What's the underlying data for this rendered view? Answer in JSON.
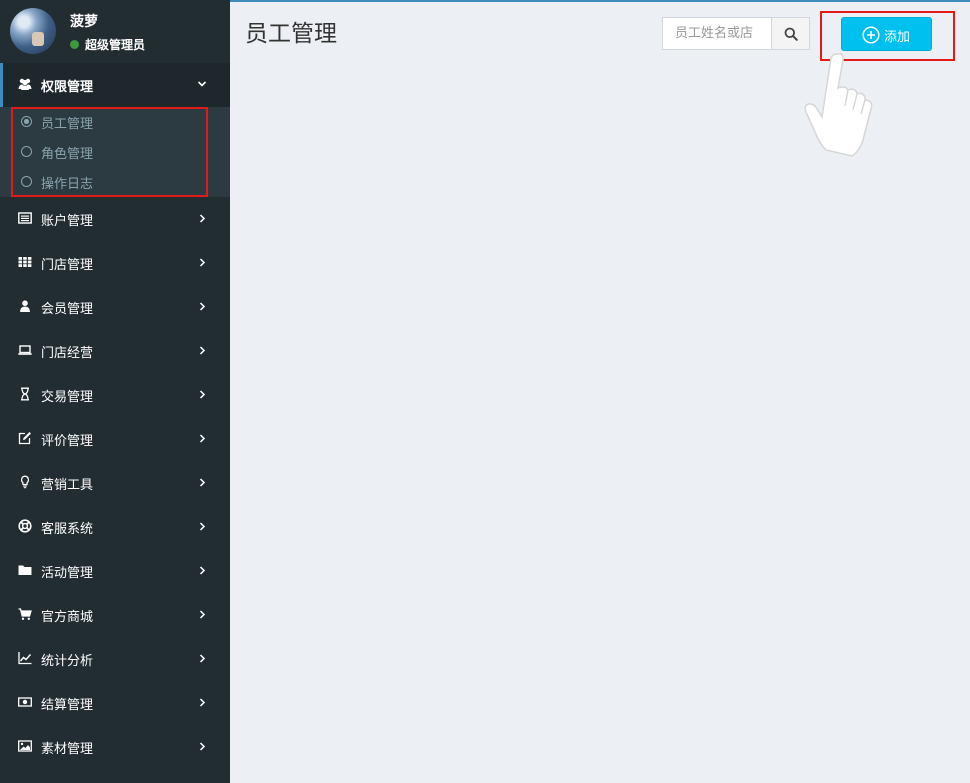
{
  "user": {
    "name": "菠萝",
    "role": "超级管理员"
  },
  "sidebar": {
    "items": [
      {
        "label": "权限管理",
        "icon": "users-icon",
        "active": true,
        "children": [
          {
            "label": "员工管理",
            "active": true
          },
          {
            "label": "角色管理",
            "active": false
          },
          {
            "label": "操作日志",
            "active": false
          }
        ]
      },
      {
        "label": "账户管理",
        "icon": "list-alt-icon"
      },
      {
        "label": "门店管理",
        "icon": "grid-icon"
      },
      {
        "label": "会员管理",
        "icon": "user-icon"
      },
      {
        "label": "门店经营",
        "icon": "laptop-icon"
      },
      {
        "label": "交易管理",
        "icon": "hourglass-icon"
      },
      {
        "label": "评价管理",
        "icon": "edit-icon"
      },
      {
        "label": "营销工具",
        "icon": "lightbulb-icon"
      },
      {
        "label": "客服系统",
        "icon": "life-ring-icon"
      },
      {
        "label": "活动管理",
        "icon": "folder-icon"
      },
      {
        "label": "官方商城",
        "icon": "cart-icon"
      },
      {
        "label": "统计分析",
        "icon": "line-chart-icon"
      },
      {
        "label": "结算管理",
        "icon": "money-icon"
      },
      {
        "label": "素材管理",
        "icon": "image-icon"
      }
    ]
  },
  "main": {
    "title": "员工管理",
    "search": {
      "placeholder": "员工姓名或店",
      "value": ""
    },
    "add_label": "添加"
  },
  "colors": {
    "sidebar_bg": "#222d32",
    "submenu_bg": "#2c3b41",
    "accent": "#3c8dbc",
    "add_button": "#00c0ef",
    "highlight": "#e31a1a",
    "content_bg": "#ecf0f5"
  }
}
